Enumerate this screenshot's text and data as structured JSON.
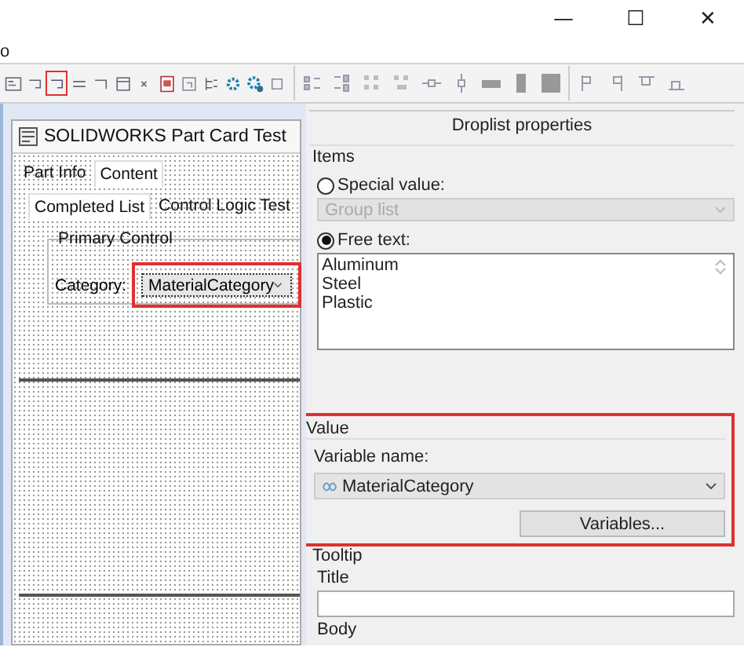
{
  "window": {
    "controls": [
      "—",
      "☐",
      "✕"
    ]
  },
  "menu_fragment": "o",
  "toolbar": [
    {
      "highlighted": false
    },
    {
      "highlighted": false
    },
    {
      "highlighted": true
    },
    {
      "highlighted": false
    },
    {
      "highlighted": false
    },
    {
      "highlighted": false
    },
    {
      "highlighted": false
    },
    {
      "highlighted": false
    },
    {
      "highlighted": false
    },
    {
      "highlighted": false
    },
    {
      "highlighted": false
    },
    {
      "highlighted": false
    },
    {
      "highlighted": false
    }
  ],
  "form": {
    "title": "SOLIDWORKS Part Card Test",
    "tabs": [
      {
        "label": "Part Info",
        "selected": false
      },
      {
        "label": "Content",
        "selected": true
      }
    ],
    "subtabs": [
      {
        "label": "Completed List",
        "selected": true
      },
      {
        "label": "Control Logic Test",
        "selected": false
      }
    ],
    "group": {
      "title": "Primary Control",
      "label": "Category:",
      "combo": "MaterialCategory",
      "highlighted": true
    }
  },
  "properties": {
    "title": "Droplist properties",
    "items": {
      "title": "Items",
      "options": [
        {
          "label": "Special value:",
          "selected": false,
          "kind": "dropdown",
          "value": "Group list",
          "disabled": true
        },
        {
          "label": "Free text:",
          "selected": true,
          "kind": "textarea",
          "lines": [
            "Aluminum",
            "Steel",
            "Plastic"
          ]
        }
      ]
    },
    "value": {
      "title": "Value",
      "highlighted": true,
      "variable_label": "Variable name:",
      "variable": "MaterialCategory",
      "button": "Variables..."
    },
    "tooltip": {
      "title": "Tooltip",
      "title_label": "Title",
      "body_label": "Body"
    }
  }
}
